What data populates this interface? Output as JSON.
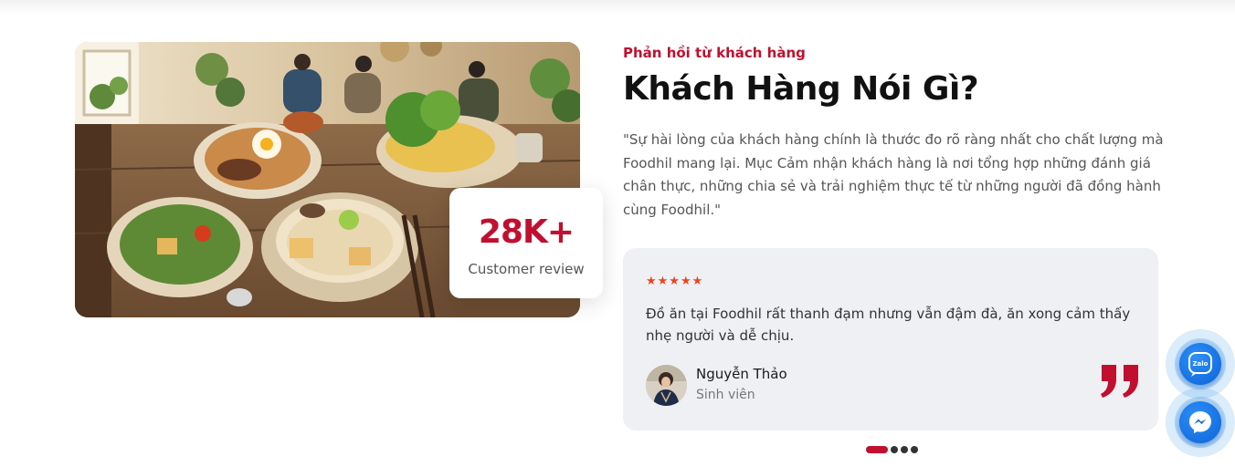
{
  "photo": {
    "alt": "Vietnamese vegetarian dishes on a wooden table"
  },
  "stat": {
    "value": "28K+",
    "label": "Customer review"
  },
  "section": {
    "eyebrow": "Phản hồi từ khách hàng",
    "title": "Khách Hàng Nói Gì?",
    "intro": "\"Sự hài lòng của khách hàng chính là thước đo rõ ràng nhất cho chất lượng mà Foodhil mang lại. Mục Cảm nhận khách hàng là nơi tổng hợp những đánh giá chân thực, những chia sẻ và trải nghiệm thực tế từ những người đã đồng hành cùng Foodhil.\""
  },
  "testimonial": {
    "stars": "★★★★★",
    "rating": 5,
    "text": "Đồ ăn tại Foodhil rất thanh đạm nhưng vẫn đậm đà, ăn xong cảm thấy nhẹ người và dễ chịu.",
    "author": "Nguyễn Thảo",
    "role": "Sinh viên"
  },
  "pagination": {
    "total": 4,
    "active": 1
  },
  "contact": {
    "zalo_icon": "zalo-icon",
    "zalo_text": "Zalo",
    "messenger_icon": "messenger-icon"
  },
  "colors": {
    "accent": "#c10f2f",
    "stars": "#e8461f",
    "card_bg": "#eef0f3",
    "fab_blue": "#1e88e5"
  }
}
